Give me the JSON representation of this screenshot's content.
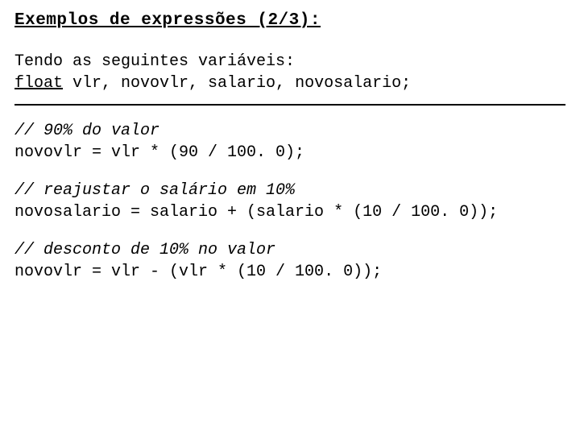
{
  "title": "Exemplos de expressões (2/3):",
  "intro": {
    "line1": "Tendo as seguintes variáveis:",
    "type_kw": "float",
    "decl_rest": " vlr, novovlr, salario, novosalario;"
  },
  "examples": [
    {
      "comment": "// 90% do valor",
      "code": "novovlr = vlr * (90 / 100. 0);"
    },
    {
      "comment": "// reajustar o salário em 10%",
      "code": "novosalario = salario + (salario * (10 / 100. 0));"
    },
    {
      "comment": "// desconto de 10% no valor",
      "code": "novovlr = vlr - (vlr * (10 / 100. 0));"
    }
  ]
}
